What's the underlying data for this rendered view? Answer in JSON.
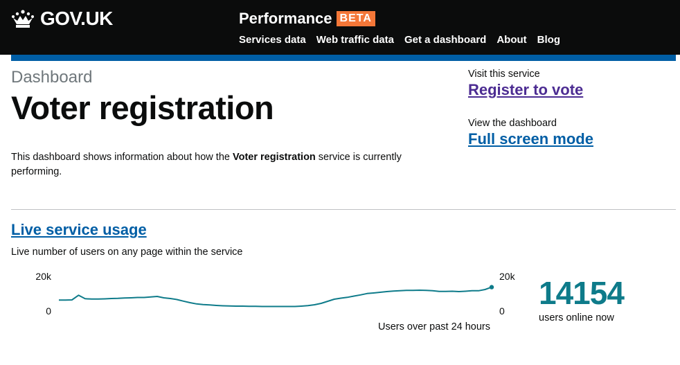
{
  "header": {
    "logo_text": "GOV.UK",
    "product_name": "Performance",
    "badge": "BETA",
    "nav": [
      "Services data",
      "Web traffic data",
      "Get a dashboard",
      "About",
      "Blog"
    ]
  },
  "intro": {
    "breadcrumb": "Dashboard",
    "title": "Voter registration",
    "desc_before": "This dashboard shows information about how the ",
    "desc_bold": "Voter registration",
    "desc_after": " service is currently performing."
  },
  "side": {
    "visit_label": "Visit this service",
    "visit_link": "Register to vote",
    "view_label": "View the dashboard",
    "view_link": "Full screen mode"
  },
  "module": {
    "title": "Live service usage",
    "description": "Live number of users on any page within the service",
    "current_value": "14154",
    "current_label": "users online now"
  },
  "colors": {
    "header_bg": "#0b0c0c",
    "brand_blue": "#005ea5",
    "badge": "#f47738",
    "link_visited": "#4c2c92",
    "series": "#0e7b8a"
  },
  "chart_data": {
    "type": "line",
    "caption": "Users over past 24 hours",
    "y_ticks": [
      "20k",
      "0"
    ],
    "ylim": [
      0,
      20000
    ],
    "series": [
      {
        "values": [
          6700,
          6700,
          6800,
          9500,
          7500,
          7300,
          7300,
          7400,
          7600,
          7700,
          7900,
          8000,
          8200,
          8200,
          8500,
          8800,
          8000,
          7600,
          7000,
          6100,
          5200,
          4500,
          4100,
          3900,
          3600,
          3400,
          3300,
          3200,
          3200,
          3100,
          3100,
          3000,
          3000,
          3000,
          3000,
          3000,
          3000,
          3200,
          3500,
          4000,
          4800,
          6000,
          7200,
          7800,
          8300,
          9000,
          9700,
          10500,
          10800,
          11200,
          11600,
          11900,
          12100,
          12300,
          12300,
          12400,
          12300,
          12100,
          11700,
          11700,
          11800,
          11600,
          11800,
          12100,
          12100,
          12800,
          14154
        ]
      }
    ]
  }
}
